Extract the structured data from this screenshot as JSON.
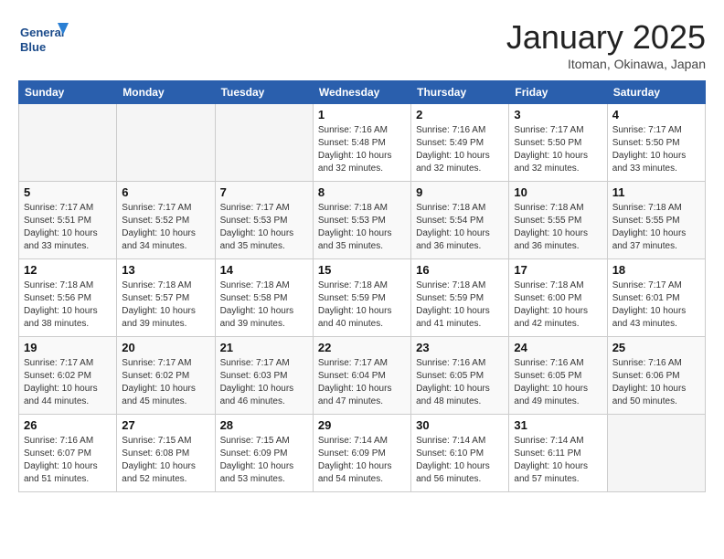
{
  "header": {
    "logo_line1": "General",
    "logo_line2": "Blue",
    "month": "January 2025",
    "location": "Itoman, Okinawa, Japan"
  },
  "weekdays": [
    "Sunday",
    "Monday",
    "Tuesday",
    "Wednesday",
    "Thursday",
    "Friday",
    "Saturday"
  ],
  "weeks": [
    [
      {
        "day": "",
        "empty": true
      },
      {
        "day": "",
        "empty": true
      },
      {
        "day": "",
        "empty": true
      },
      {
        "day": "1",
        "sunrise": "7:16 AM",
        "sunset": "5:48 PM",
        "daylight": "10 hours and 32 minutes."
      },
      {
        "day": "2",
        "sunrise": "7:16 AM",
        "sunset": "5:49 PM",
        "daylight": "10 hours and 32 minutes."
      },
      {
        "day": "3",
        "sunrise": "7:17 AM",
        "sunset": "5:50 PM",
        "daylight": "10 hours and 32 minutes."
      },
      {
        "day": "4",
        "sunrise": "7:17 AM",
        "sunset": "5:50 PM",
        "daylight": "10 hours and 33 minutes."
      }
    ],
    [
      {
        "day": "5",
        "sunrise": "7:17 AM",
        "sunset": "5:51 PM",
        "daylight": "10 hours and 33 minutes."
      },
      {
        "day": "6",
        "sunrise": "7:17 AM",
        "sunset": "5:52 PM",
        "daylight": "10 hours and 34 minutes."
      },
      {
        "day": "7",
        "sunrise": "7:17 AM",
        "sunset": "5:53 PM",
        "daylight": "10 hours and 35 minutes."
      },
      {
        "day": "8",
        "sunrise": "7:18 AM",
        "sunset": "5:53 PM",
        "daylight": "10 hours and 35 minutes."
      },
      {
        "day": "9",
        "sunrise": "7:18 AM",
        "sunset": "5:54 PM",
        "daylight": "10 hours and 36 minutes."
      },
      {
        "day": "10",
        "sunrise": "7:18 AM",
        "sunset": "5:55 PM",
        "daylight": "10 hours and 36 minutes."
      },
      {
        "day": "11",
        "sunrise": "7:18 AM",
        "sunset": "5:55 PM",
        "daylight": "10 hours and 37 minutes."
      }
    ],
    [
      {
        "day": "12",
        "sunrise": "7:18 AM",
        "sunset": "5:56 PM",
        "daylight": "10 hours and 38 minutes."
      },
      {
        "day": "13",
        "sunrise": "7:18 AM",
        "sunset": "5:57 PM",
        "daylight": "10 hours and 39 minutes."
      },
      {
        "day": "14",
        "sunrise": "7:18 AM",
        "sunset": "5:58 PM",
        "daylight": "10 hours and 39 minutes."
      },
      {
        "day": "15",
        "sunrise": "7:18 AM",
        "sunset": "5:59 PM",
        "daylight": "10 hours and 40 minutes."
      },
      {
        "day": "16",
        "sunrise": "7:18 AM",
        "sunset": "5:59 PM",
        "daylight": "10 hours and 41 minutes."
      },
      {
        "day": "17",
        "sunrise": "7:18 AM",
        "sunset": "6:00 PM",
        "daylight": "10 hours and 42 minutes."
      },
      {
        "day": "18",
        "sunrise": "7:17 AM",
        "sunset": "6:01 PM",
        "daylight": "10 hours and 43 minutes."
      }
    ],
    [
      {
        "day": "19",
        "sunrise": "7:17 AM",
        "sunset": "6:02 PM",
        "daylight": "10 hours and 44 minutes."
      },
      {
        "day": "20",
        "sunrise": "7:17 AM",
        "sunset": "6:02 PM",
        "daylight": "10 hours and 45 minutes."
      },
      {
        "day": "21",
        "sunrise": "7:17 AM",
        "sunset": "6:03 PM",
        "daylight": "10 hours and 46 minutes."
      },
      {
        "day": "22",
        "sunrise": "7:17 AM",
        "sunset": "6:04 PM",
        "daylight": "10 hours and 47 minutes."
      },
      {
        "day": "23",
        "sunrise": "7:16 AM",
        "sunset": "6:05 PM",
        "daylight": "10 hours and 48 minutes."
      },
      {
        "day": "24",
        "sunrise": "7:16 AM",
        "sunset": "6:05 PM",
        "daylight": "10 hours and 49 minutes."
      },
      {
        "day": "25",
        "sunrise": "7:16 AM",
        "sunset": "6:06 PM",
        "daylight": "10 hours and 50 minutes."
      }
    ],
    [
      {
        "day": "26",
        "sunrise": "7:16 AM",
        "sunset": "6:07 PM",
        "daylight": "10 hours and 51 minutes."
      },
      {
        "day": "27",
        "sunrise": "7:15 AM",
        "sunset": "6:08 PM",
        "daylight": "10 hours and 52 minutes."
      },
      {
        "day": "28",
        "sunrise": "7:15 AM",
        "sunset": "6:09 PM",
        "daylight": "10 hours and 53 minutes."
      },
      {
        "day": "29",
        "sunrise": "7:14 AM",
        "sunset": "6:09 PM",
        "daylight": "10 hours and 54 minutes."
      },
      {
        "day": "30",
        "sunrise": "7:14 AM",
        "sunset": "6:10 PM",
        "daylight": "10 hours and 56 minutes."
      },
      {
        "day": "31",
        "sunrise": "7:14 AM",
        "sunset": "6:11 PM",
        "daylight": "10 hours and 57 minutes."
      },
      {
        "day": "",
        "empty": true
      }
    ]
  ]
}
